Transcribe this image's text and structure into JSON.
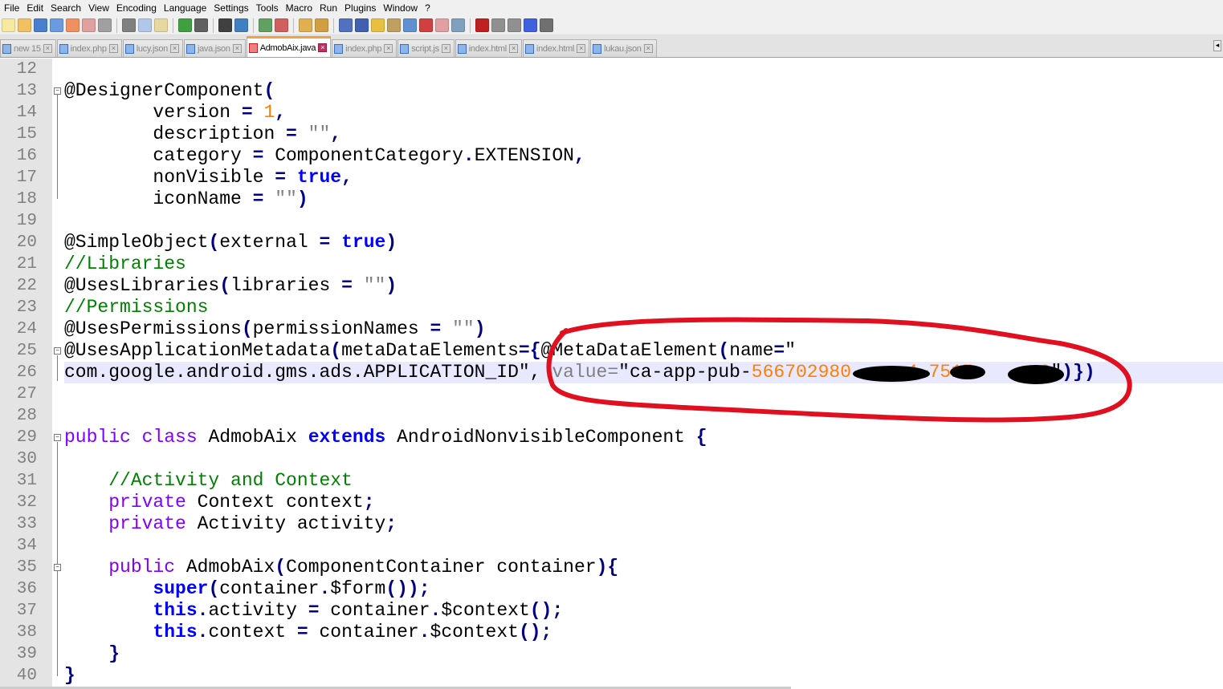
{
  "menu": [
    "File",
    "Edit",
    "Search",
    "View",
    "Encoding",
    "Language",
    "Settings",
    "Tools",
    "Macro",
    "Run",
    "Plugins",
    "Window",
    "?"
  ],
  "toolbar_icons": [
    "new-file-icon",
    "open-file-icon",
    "save-icon",
    "save-all-icon",
    "close-icon",
    "close-all-icon",
    "print-icon",
    "|",
    "cut-icon",
    "copy-icon",
    "paste-icon",
    "|",
    "undo-icon",
    "redo-icon",
    "|",
    "find-icon",
    "replace-icon",
    "|",
    "zoom-in-icon",
    "zoom-out-icon",
    "|",
    "sync-vertical-icon",
    "sync-horizontal-icon",
    "|",
    "word-wrap-icon",
    "show-all-chars-icon",
    "indent-guide-icon",
    "user-language-icon",
    "document-map-icon",
    "function-list-icon",
    "folder-workspace-icon",
    "monitoring-icon",
    "|",
    "record-macro-icon",
    "stop-macro-icon",
    "play-macro-icon",
    "run-macro-multiple-icon",
    "save-macro-icon"
  ],
  "tabs": [
    {
      "label": "new 15",
      "active": false
    },
    {
      "label": "index.php",
      "active": false
    },
    {
      "label": "lucy.json",
      "active": false
    },
    {
      "label": "java.json",
      "active": false
    },
    {
      "label": "AdmobAix.java",
      "active": true
    },
    {
      "label": "index.php",
      "active": false
    },
    {
      "label": "script.js",
      "active": false
    },
    {
      "label": "index.html",
      "active": false
    },
    {
      "label": "index.html",
      "active": false
    },
    {
      "label": "lukau.json",
      "active": false
    }
  ],
  "tab_close": "×",
  "tab_scroll": "◂",
  "current_line": 26,
  "lines": [
    {
      "n": "12",
      "t": []
    },
    {
      "n": "13",
      "fold": "box",
      "t": [
        [
          "@DesignerComponent",
          "t"
        ],
        [
          "(",
          "o"
        ]
      ]
    },
    {
      "n": "14",
      "t": [
        [
          "        version ",
          "t"
        ],
        [
          "=",
          "o"
        ],
        [
          " ",
          "t"
        ],
        [
          "1",
          "n"
        ],
        [
          ",",
          "o"
        ]
      ]
    },
    {
      "n": "15",
      "t": [
        [
          "        description ",
          "t"
        ],
        [
          "=",
          "o"
        ],
        [
          " ",
          "t"
        ],
        [
          "\"\"",
          "s"
        ],
        [
          ",",
          "o"
        ]
      ]
    },
    {
      "n": "16",
      "t": [
        [
          "        category ",
          "t"
        ],
        [
          "=",
          "o"
        ],
        [
          " ComponentCategory",
          "t"
        ],
        [
          ".",
          "o"
        ],
        [
          "EXTENSION",
          "t"
        ],
        [
          ",",
          "o"
        ]
      ]
    },
    {
      "n": "17",
      "t": [
        [
          "        nonVisible ",
          "t"
        ],
        [
          "=",
          "o"
        ],
        [
          " ",
          "t"
        ],
        [
          "true",
          "k"
        ],
        [
          ",",
          "o"
        ]
      ]
    },
    {
      "n": "18",
      "t": [
        [
          "        iconName ",
          "t"
        ],
        [
          "=",
          "o"
        ],
        [
          " ",
          "t"
        ],
        [
          "\"\"",
          "s"
        ],
        [
          ")",
          "o"
        ]
      ]
    },
    {
      "n": "19",
      "t": []
    },
    {
      "n": "20",
      "t": [
        [
          "@SimpleObject",
          "t"
        ],
        [
          "(",
          "o"
        ],
        [
          "external ",
          "t"
        ],
        [
          "=",
          "o"
        ],
        [
          " ",
          "t"
        ],
        [
          "true",
          "k"
        ],
        [
          ")",
          "o"
        ]
      ]
    },
    {
      "n": "21",
      "t": [
        [
          "//Libraries",
          "c"
        ]
      ]
    },
    {
      "n": "22",
      "t": [
        [
          "@UsesLibraries",
          "t"
        ],
        [
          "(",
          "o"
        ],
        [
          "libraries ",
          "t"
        ],
        [
          "=",
          "o"
        ],
        [
          " ",
          "t"
        ],
        [
          "\"\"",
          "s"
        ],
        [
          ")",
          "o"
        ]
      ]
    },
    {
      "n": "23",
      "t": [
        [
          "//Permissions",
          "c"
        ]
      ]
    },
    {
      "n": "24",
      "t": [
        [
          "@UsesPermissions",
          "t"
        ],
        [
          "(",
          "o"
        ],
        [
          "permissionNames ",
          "t"
        ],
        [
          "=",
          "o"
        ],
        [
          " ",
          "t"
        ],
        [
          "\"\"",
          "s"
        ],
        [
          ")",
          "o"
        ]
      ]
    },
    {
      "n": "25",
      "fold": "box",
      "t": [
        [
          "@UsesApplicationMetadata",
          "t"
        ],
        [
          "(",
          "o"
        ],
        [
          "metaDataElements",
          "t"
        ],
        [
          "={",
          "o"
        ],
        [
          "@MetaDataElement",
          "t"
        ],
        [
          "(",
          "o"
        ],
        [
          "name",
          "t"
        ],
        [
          "=",
          "o"
        ],
        [
          "\"",
          "t"
        ]
      ]
    },
    {
      "n": "26",
      "t": [
        [
          "com.google.android.gms.ads.APPLICATION_ID\",",
          "t"
        ],
        [
          " ",
          "t"
        ],
        [
          "value=",
          "a"
        ],
        [
          "\"ca-app-pub-",
          "t"
        ],
        [
          "566702980     4~7515      0",
          "n"
        ],
        [
          "\"",
          "t"
        ],
        [
          ")})",
          "o"
        ]
      ]
    },
    {
      "n": "27",
      "t": []
    },
    {
      "n": "28",
      "t": []
    },
    {
      "n": "29",
      "fold": "box",
      "t": [
        [
          "public",
          "p"
        ],
        [
          " ",
          "t"
        ],
        [
          "class",
          "p"
        ],
        [
          " AdmobAix ",
          "t"
        ],
        [
          "extends",
          "k"
        ],
        [
          " AndroidNonvisibleComponent ",
          "t"
        ],
        [
          "{",
          "o"
        ]
      ]
    },
    {
      "n": "30",
      "t": []
    },
    {
      "n": "31",
      "t": [
        [
          "    //Activity and Context",
          "c"
        ]
      ]
    },
    {
      "n": "32",
      "t": [
        [
          "    ",
          "t"
        ],
        [
          "private",
          "p"
        ],
        [
          " Context context",
          "t"
        ],
        [
          ";",
          "o"
        ]
      ]
    },
    {
      "n": "33",
      "t": [
        [
          "    ",
          "t"
        ],
        [
          "private",
          "p"
        ],
        [
          " Activity activity",
          "t"
        ],
        [
          ";",
          "o"
        ]
      ]
    },
    {
      "n": "34",
      "t": []
    },
    {
      "n": "35",
      "fold": "box",
      "t": [
        [
          "    ",
          "t"
        ],
        [
          "public",
          "p"
        ],
        [
          " AdmobAix",
          "t"
        ],
        [
          "(",
          "o"
        ],
        [
          "ComponentContainer container",
          "t"
        ],
        [
          "){",
          "o"
        ]
      ]
    },
    {
      "n": "36",
      "t": [
        [
          "        ",
          "t"
        ],
        [
          "super",
          "k"
        ],
        [
          "(",
          "o"
        ],
        [
          "container",
          "t"
        ],
        [
          ".",
          "o"
        ],
        [
          "$form",
          "t"
        ],
        [
          "());",
          "o"
        ]
      ]
    },
    {
      "n": "37",
      "t": [
        [
          "        ",
          "t"
        ],
        [
          "this",
          "k"
        ],
        [
          ".",
          "o"
        ],
        [
          "activity ",
          "t"
        ],
        [
          "=",
          "o"
        ],
        [
          " container",
          "t"
        ],
        [
          ".",
          "o"
        ],
        [
          "$context",
          "t"
        ],
        [
          "();",
          "o"
        ]
      ]
    },
    {
      "n": "38",
      "t": [
        [
          "        ",
          "t"
        ],
        [
          "this",
          "k"
        ],
        [
          ".",
          "o"
        ],
        [
          "context ",
          "t"
        ],
        [
          "=",
          "o"
        ],
        [
          " container",
          "t"
        ],
        [
          ".",
          "o"
        ],
        [
          "$context",
          "t"
        ],
        [
          "();",
          "o"
        ]
      ]
    },
    {
      "n": "39",
      "t": [
        [
          "    ",
          "t"
        ],
        [
          "}",
          "o"
        ]
      ]
    },
    {
      "n": "40",
      "t": [
        [
          "}",
          "o"
        ]
      ]
    }
  ],
  "colors": {
    "annotation_circle": "#e01020",
    "redaction": "#000000",
    "current_line": "#e8e8ff"
  }
}
